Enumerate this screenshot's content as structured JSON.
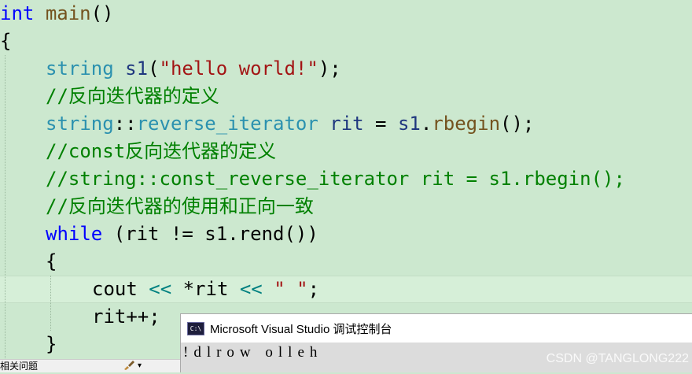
{
  "code": {
    "line1": {
      "kw": "int",
      "fn": "main",
      "rest": "()"
    },
    "line2": "{",
    "line3": {
      "ty": "string",
      "var": "s1",
      "open": "(",
      "str": "\"hello world!\"",
      "close": ");"
    },
    "line4": {
      "cm": "//",
      "cjk": "反向迭代器的定义"
    },
    "line5": {
      "ty1": "string",
      "sep": "::",
      "ty2": "reverse_iterator",
      "var1": "rit",
      "eq": " = ",
      "var2": "s1",
      "dot": ".",
      "fn": "rbegin",
      "rest": "();"
    },
    "line6": {
      "cm": "//const",
      "cjk": "反向迭代器的定义"
    },
    "line7": "//string::const_reverse_iterator rit = s1.rbegin();",
    "line8": {
      "cm": "//",
      "cjk": "反向迭代器的使用和正向一致"
    },
    "line9": {
      "kw": "while",
      "rest": " (rit != s1.rend())"
    },
    "line10": "{",
    "line11": {
      "a": "cout ",
      "op1": "<<",
      "b": " *rit ",
      "op2": "<<",
      "c": " ",
      "str": "\" \"",
      "d": ";"
    },
    "line12": "rit++;",
    "line13": "}"
  },
  "console": {
    "icon_text": "C:\\",
    "title": "Microsoft Visual Studio 调试控制台",
    "output": "!dlrow olleh"
  },
  "bottom_tab": {
    "label": "相关问题",
    "brush_icon": "brush-icon",
    "arrow": "▾"
  },
  "watermark": "CSDN @TANGLONG222"
}
